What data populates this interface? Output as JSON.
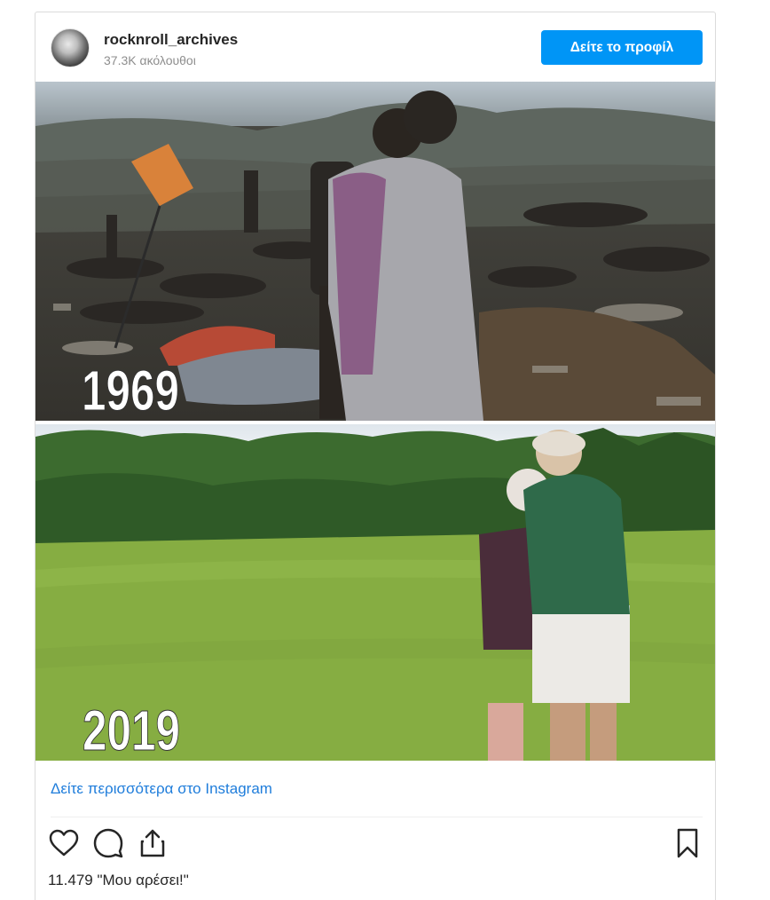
{
  "post": {
    "username": "rocknroll_archives",
    "followers": "37.3K ακόλουθοι",
    "profile_button": "Δείτε το προφίλ",
    "photo_top_year": "1969",
    "photo_bottom_year": "2019",
    "view_more": "Δείτε περισσότερα στο Instagram",
    "likes": "11.479 \"Μου αρέσει!\""
  },
  "icons": {
    "like": "heart-icon",
    "comment": "comment-icon",
    "share": "share-icon",
    "save": "bookmark-icon"
  },
  "colors": {
    "button": "#0095f6",
    "link": "#1f7ddb",
    "text": "#262626",
    "muted": "#8e8e8e"
  }
}
